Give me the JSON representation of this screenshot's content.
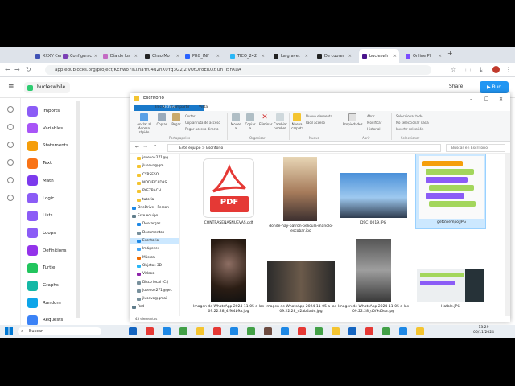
{
  "browser": {
    "tabs": [
      {
        "label": "XXXV Cer",
        "color": "#3f51b5"
      },
      {
        "label": "Configurac",
        "color": "#7b3fb5"
      },
      {
        "label": "Día de los",
        "color": "#c46bc4"
      },
      {
        "label": "Chao Mo",
        "color": "#222222"
      },
      {
        "label": "PRG_INF",
        "color": "#2962ff"
      },
      {
        "label": "TICO_242",
        "color": "#29b6f6"
      },
      {
        "label": "La gravet",
        "color": "#222222"
      },
      {
        "label": "De cuorer",
        "color": "#222222"
      },
      {
        "label": "bucleswh",
        "color": "#4a148c"
      },
      {
        "label": "Online Pl",
        "color": "#7c4dff"
      }
    ],
    "url": "app.edublocks.org/project/KEhwo7lKi.naYfu4u2hX0Yq3G2j2.vUtUFoEI0Xt Uh lI5hKuA"
  },
  "app": {
    "project_name": "bucleswhile",
    "share_label": "Share",
    "run_label": "Run",
    "categories": [
      {
        "label": "Imports",
        "color": "#8b5cf6",
        "icon": "import-icon"
      },
      {
        "label": "Variables",
        "color": "#a855f7",
        "icon": "variable-icon"
      },
      {
        "label": "Statements",
        "color": "#f59e0b",
        "icon": "statement-icon"
      },
      {
        "label": "Text",
        "color": "#f97316",
        "icon": "text-icon"
      },
      {
        "label": "Math",
        "color": "#7c3aed",
        "icon": "math-icon"
      },
      {
        "label": "Logic",
        "color": "#8b5cf6",
        "icon": "logic-icon"
      },
      {
        "label": "Lists",
        "color": "#8b5cf6",
        "icon": "list-icon"
      },
      {
        "label": "Loops",
        "color": "#8b5cf6",
        "icon": "loop-icon"
      },
      {
        "label": "Definitions",
        "color": "#9333ea",
        "icon": "definition-icon"
      },
      {
        "label": "Turtle",
        "color": "#22c55e",
        "icon": "turtle-icon"
      },
      {
        "label": "Graphs",
        "color": "#14b8a6",
        "icon": "graph-icon"
      },
      {
        "label": "Random",
        "color": "#0ea5e9",
        "icon": "random-icon"
      },
      {
        "label": "Requests",
        "color": "#3b82f6",
        "icon": "requests-icon"
      }
    ]
  },
  "explorer": {
    "title": "Escritorio",
    "ribbon_tabs": [
      "Archivo",
      "Inicio",
      "Compartir",
      "Vista"
    ],
    "ribbon": {
      "pin": "Anclar al Acceso rápido",
      "copy": "Copiar",
      "paste": "Pegar",
      "cut": "Cortar",
      "copy_path": "Copiar ruta de acceso",
      "paste_shortcut": "Pegar acceso directo",
      "move": "Mover a",
      "copy_to": "Copiar a",
      "delete": "Eliminar",
      "rename": "Cambiar nombre",
      "new_folder": "Nueva carpeta",
      "new_item": "Nuevo elemento",
      "easy_access": "Fácil acceso",
      "properties": "Propiedades",
      "open": "Abrir",
      "edit": "Modificar",
      "history": "Historial",
      "select_all": "Seleccionar todo",
      "select_none": "No seleccionar nada",
      "invert_selection": "Invertir selección",
      "groups": [
        "Portapapeles",
        "Organizar",
        "Nuevo",
        "Abrir",
        "Seleccionar"
      ]
    },
    "path": "Este equipo  >  Escritorio",
    "search_placeholder": "Buscar en Escritorio",
    "nav": [
      {
        "label": "jsuevo4271@g",
        "color": "#f4c430"
      },
      {
        "label": "jlusevo@gm",
        "color": "#f4c430"
      },
      {
        "label": "CYRSESO",
        "color": "#f4c430"
      },
      {
        "label": "MODIFICADAS",
        "color": "#f4c430"
      },
      {
        "label": "PYEZBACH",
        "color": "#f4c430"
      },
      {
        "label": "tutoria",
        "color": "#f4c430"
      },
      {
        "label": "OneDrive - Person",
        "color": "#1e88e5"
      },
      {
        "label": "Este equipo",
        "color": "#607d8b"
      },
      {
        "label": "Descargas",
        "color": "#1e88e5"
      },
      {
        "label": "Documentos",
        "color": "#78909c"
      },
      {
        "label": "Escritorio",
        "color": "#1e88e5"
      },
      {
        "label": "Imágenes",
        "color": "#42a5f5"
      },
      {
        "label": "Música",
        "color": "#ef6c00"
      },
      {
        "label": "Objetos 3D",
        "color": "#29b6f6"
      },
      {
        "label": "Vídeos",
        "color": "#8e24aa"
      },
      {
        "label": "Disco local (C:)",
        "color": "#78909c"
      },
      {
        "label": "jusevo4271@gec",
        "color": "#78909c"
      },
      {
        "label": "jlusevo@gmai",
        "color": "#78909c"
      },
      {
        "label": "Red",
        "color": "#607d8b"
      }
    ],
    "files": [
      "CONTRASEÑASNUEVAS.pdf",
      "donde-hay-patron-pelicula-manolo-escobar.jpg",
      "DSC_0019.JPG",
      "getoSiempo.JPG",
      "Imagen de WhatsApp 2024-11-05 a las 09.22.28_4f9f4b9a.jpg",
      "Imagen de WhatsApp 2024-11-05 a las 09.22.28_d2ab4ade.jpg",
      "Imagen de WhatsApp 2024-11-05 a las 09.22.28_d0f9d5ea.jpg",
      "Hatble.JPG"
    ],
    "status": "43 elementos",
    "pdf_label": "PDF"
  },
  "taskbar": {
    "search_label": "Buscar",
    "time": "13:29",
    "date": "06/11/2024"
  }
}
